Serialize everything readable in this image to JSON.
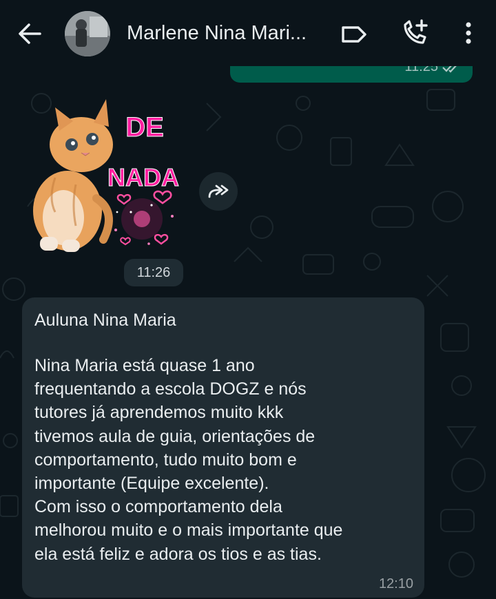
{
  "header": {
    "contact_name": "Marlene Nina Mari...",
    "icons": [
      "back-arrow-icon",
      "avatar",
      "label-icon",
      "add-call-icon",
      "more-vert-icon"
    ]
  },
  "outgoing": {
    "time": "11:25",
    "status_icon": "double-check-icon"
  },
  "sticker": {
    "text_line1": "DE",
    "text_line2": "NADA",
    "time": "11:26",
    "forward_icon": "forward-icon"
  },
  "incoming": {
    "sender": "Auluna Nina Maria",
    "lines": [
      "Nina Maria está quase 1 ano",
      "frequentando a escola DOGZ e nós",
      "tutores já aprendemos muito kkk",
      "tivemos aula de guia, orientações de",
      "comportamento, tudo muito bom e",
      "importante (Equipe excelente).",
      "Com isso o comportamento dela",
      "melhorou muito e o mais importante que",
      "ela está feliz e adora os tios e as tias."
    ],
    "time": "12:10"
  },
  "colors": {
    "background": "#0b141a",
    "incoming_bubble": "#202c33",
    "outgoing_bubble": "#005c4b",
    "sticker_text": "#ff1fa0"
  }
}
